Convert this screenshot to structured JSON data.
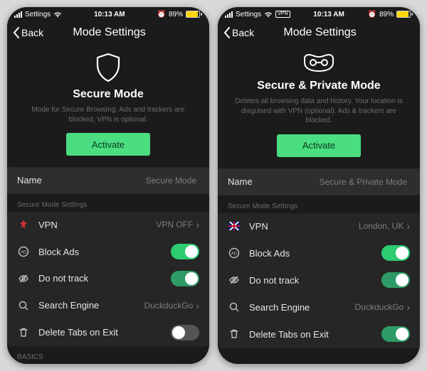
{
  "screens": [
    {
      "statusBar": {
        "appLabel": "Settings",
        "time": "10:13 AM",
        "showVpn": false,
        "batteryPercent": "89%",
        "batteryFill": 89
      },
      "nav": {
        "back": "Back",
        "title": "Mode Settings"
      },
      "hero": {
        "iconName": "shield-icon",
        "title": "Secure Mode",
        "description": "Mode for Secure Browsing. Ads and trackers are blocked, VPN is optional.",
        "activate": "Activate"
      },
      "nameRow": {
        "label": "Name",
        "value": "Secure Mode"
      },
      "sectionHeader": "Secure Mode Settings",
      "rows": {
        "vpn": {
          "label": "VPN",
          "value": "VPN OFF",
          "flag": "none",
          "type": "link"
        },
        "blockAds": {
          "label": "Block Ads",
          "type": "toggle",
          "on": true,
          "bright": true
        },
        "doNotTrack": {
          "label": "Do not track",
          "type": "toggle",
          "on": true,
          "bright": false
        },
        "searchEngine": {
          "label": "Search Engine",
          "value": "DuckduckGo",
          "type": "link"
        },
        "deleteTabs": {
          "label": "Delete Tabs on Exit",
          "type": "toggle",
          "on": false
        }
      },
      "footerHeader": "BASICS"
    },
    {
      "statusBar": {
        "appLabel": "Settings",
        "time": "10:13 AM",
        "showVpn": true,
        "batteryPercent": "89%",
        "batteryFill": 89
      },
      "nav": {
        "back": "Back",
        "title": "Mode Settings"
      },
      "hero": {
        "iconName": "mask-icon",
        "title": "Secure & Private Mode",
        "description": "Deletes all browsing data and history. Your location is disguised with VPN (optional). Ads & trackers are blocked.",
        "activate": "Activate"
      },
      "nameRow": {
        "label": "Name",
        "value": "Secure & Private Mode"
      },
      "sectionHeader": "Secure Mode Settings",
      "rows": {
        "vpn": {
          "label": "VPN",
          "value": "London, UK",
          "flag": "uk",
          "type": "link"
        },
        "blockAds": {
          "label": "Block Ads",
          "type": "toggle",
          "on": true,
          "bright": true
        },
        "doNotTrack": {
          "label": "Do not track",
          "type": "toggle",
          "on": true,
          "bright": false
        },
        "searchEngine": {
          "label": "Search Engine",
          "value": "DuckduckGo",
          "type": "link"
        },
        "deleteTabs": {
          "label": "Delete Tabs on Exit",
          "type": "toggle",
          "on": true,
          "bright": false
        }
      },
      "footerHeader": ""
    }
  ]
}
